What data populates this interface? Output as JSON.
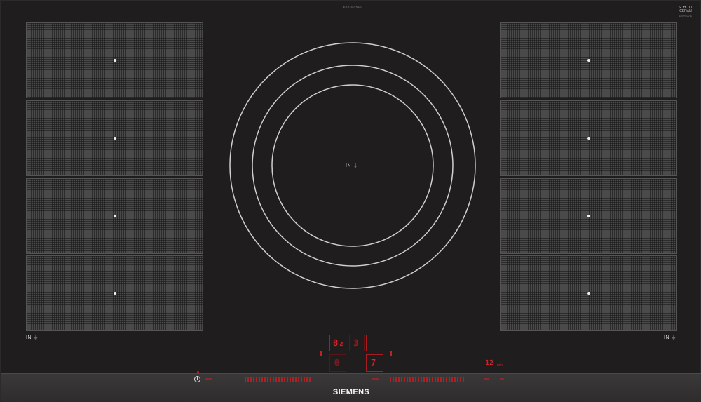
{
  "model_label": "EX975LVV1E",
  "logo": {
    "line1": "SCHOTT",
    "line2": "CERAN",
    "sub": "EX975LVV1E"
  },
  "zones": {
    "left": [
      "zone-1",
      "zone-2",
      "zone-3",
      "zone-4"
    ],
    "right": [
      "zone-5",
      "zone-6",
      "zone-7",
      "zone-8"
    ]
  },
  "induction_marks": {
    "left": "IN ⏚",
    "center": "IN ⏚",
    "right": "IN ⏚"
  },
  "display": {
    "top_left": "8.",
    "top_left_sub": "5",
    "top_mid": "3",
    "bottom_left": "0",
    "bottom_right": "7",
    "timer": "12",
    "timer_unit": "min"
  },
  "brand": "SIEMENS",
  "colors": {
    "accent_red": "#c22024",
    "glass": "#1f1d1e",
    "zone_grey": "#4a4a4a"
  }
}
